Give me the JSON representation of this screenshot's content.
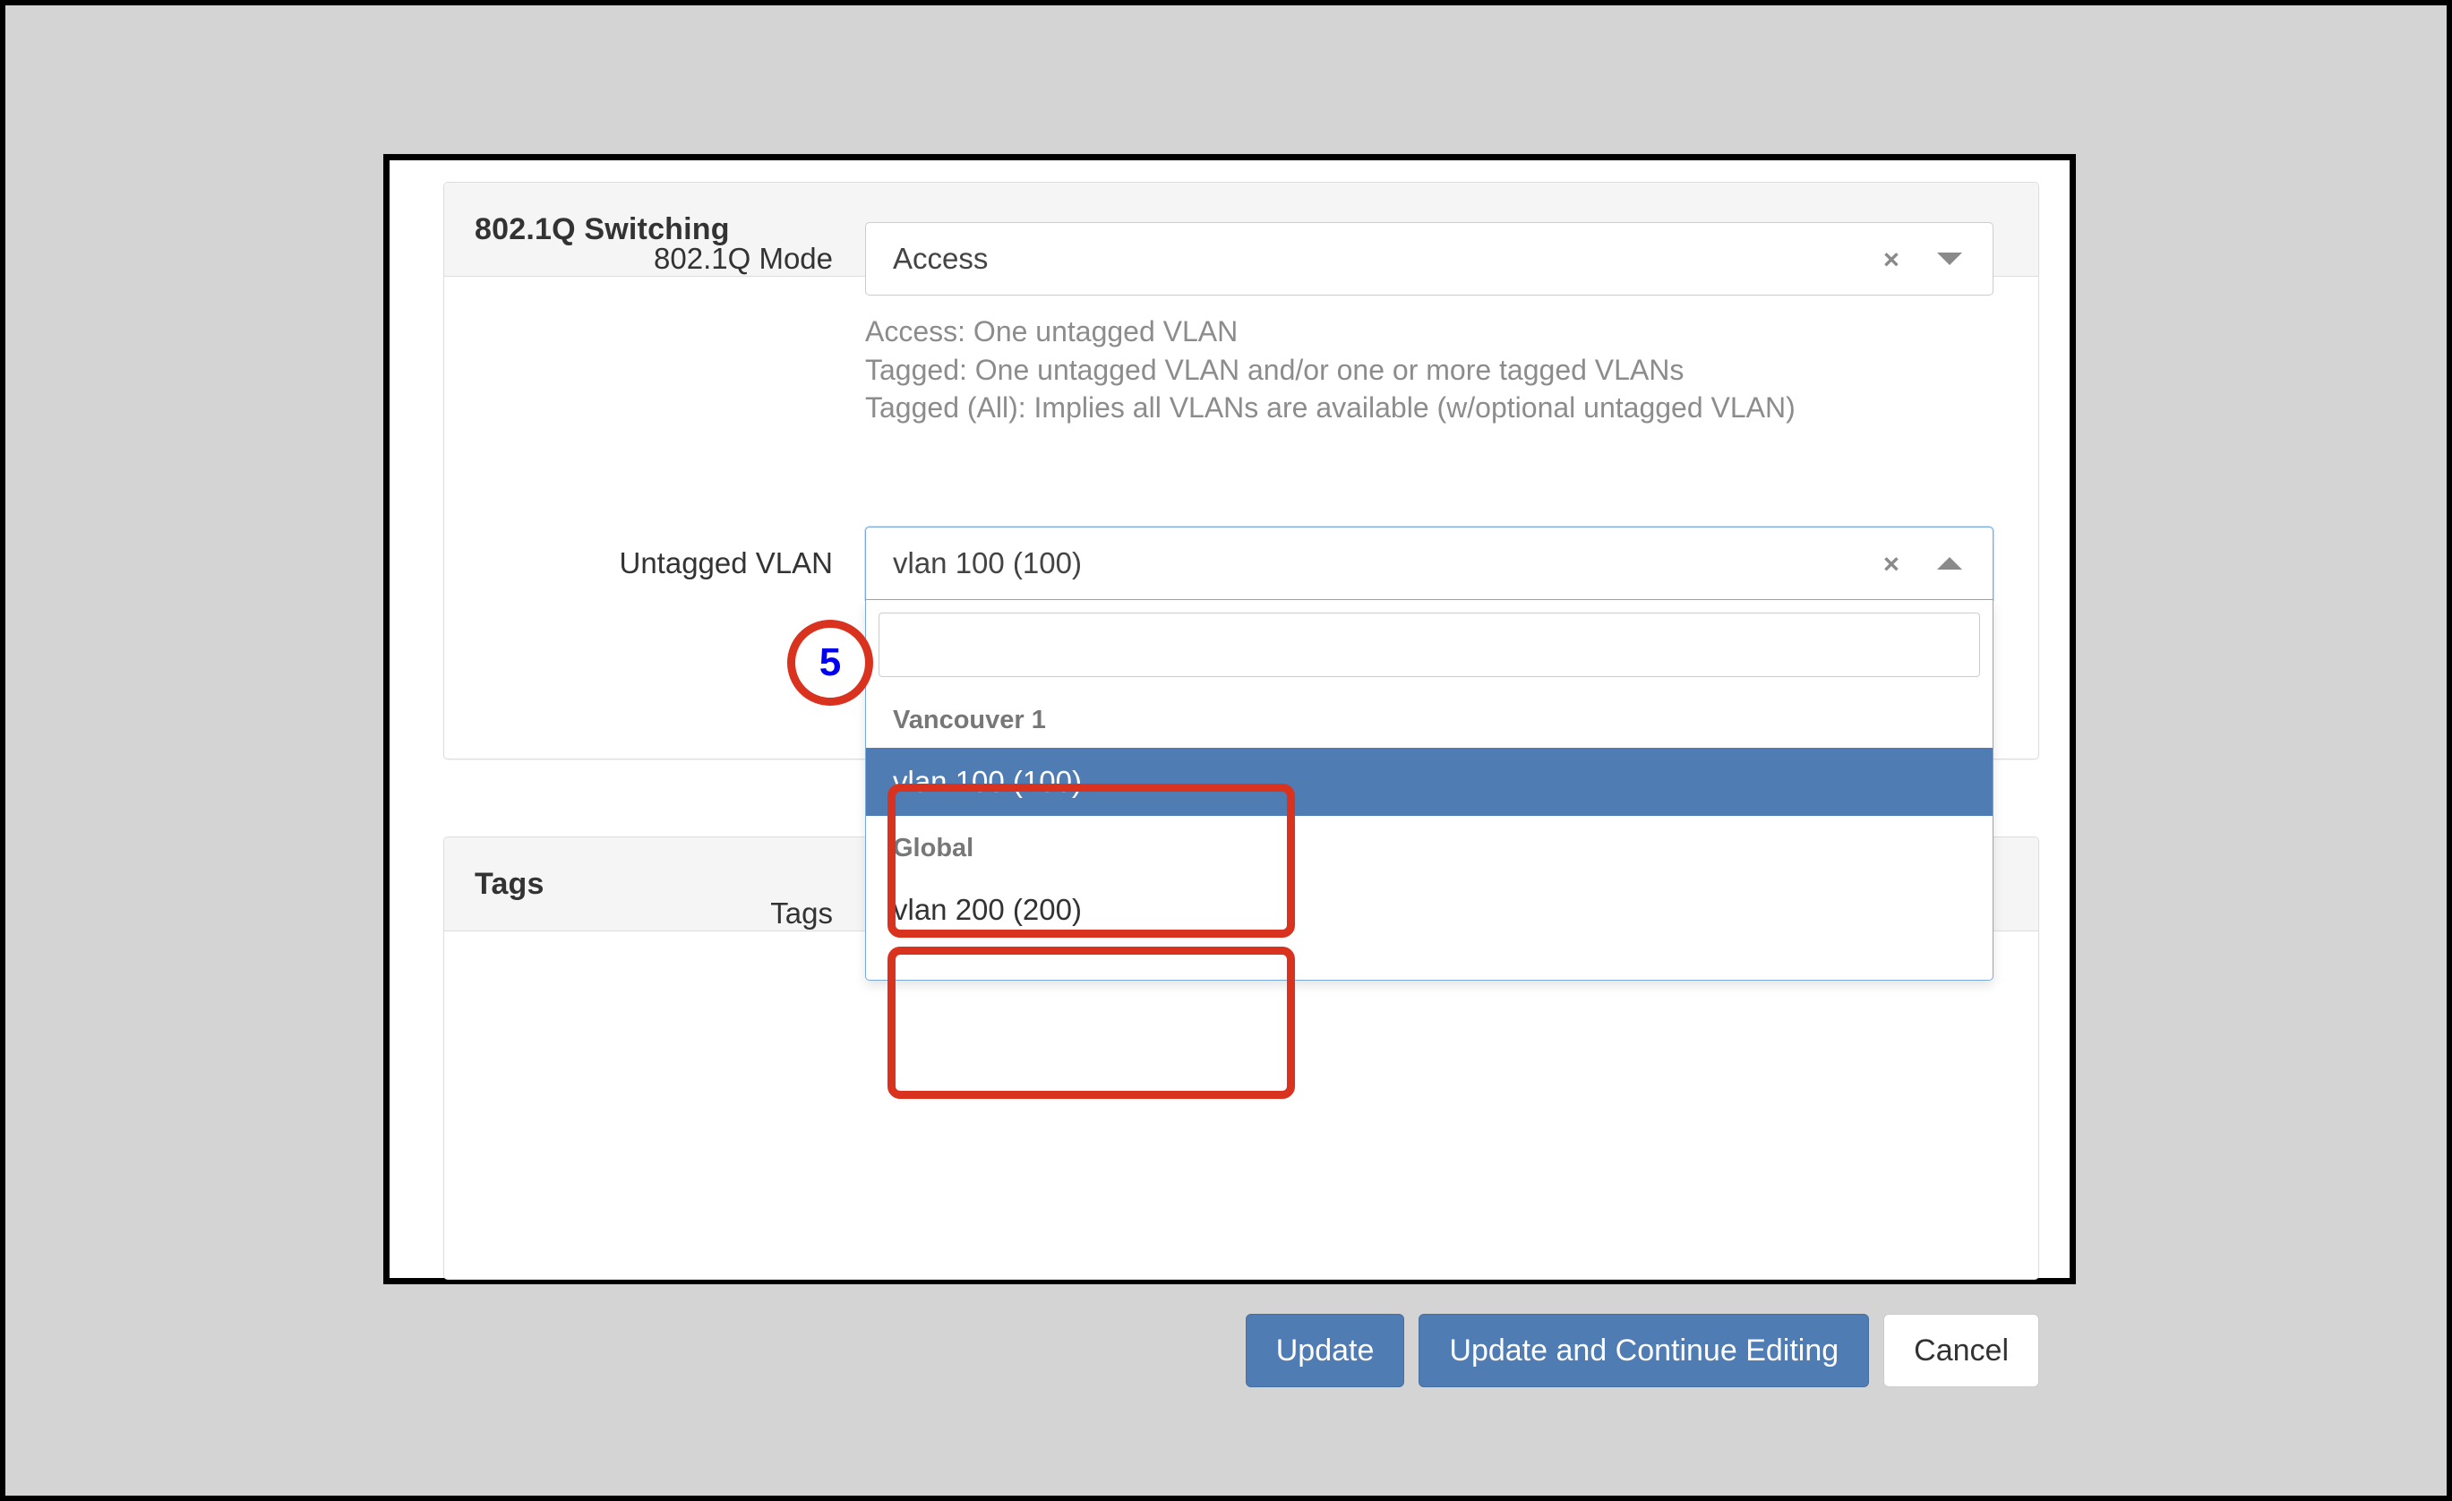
{
  "panels": {
    "switching": {
      "title": "802.1Q Switching",
      "mode_field": {
        "label": "802.1Q Mode",
        "value": "Access",
        "clear_icon": "×",
        "caret_icon": "caret-down"
      },
      "help_lines": [
        "Access: One untagged VLAN",
        "Tagged: One untagged VLAN and/or one or more tagged VLANs",
        "Tagged (All): Implies all VLANs are available (w/optional untagged VLAN)"
      ],
      "untagged_field": {
        "label": "Untagged VLAN",
        "value": "vlan 100 (100)",
        "clear_icon": "×",
        "caret_icon": "caret-up",
        "search_value": "",
        "search_placeholder": "",
        "groups": [
          {
            "group_label": "Vancouver 1",
            "options": [
              {
                "label": "vlan 100 (100)",
                "selected": true
              }
            ]
          },
          {
            "group_label": "Global",
            "options": [
              {
                "label": "vlan 200 (200)",
                "selected": false
              }
            ]
          }
        ]
      }
    },
    "tags": {
      "title": "Tags",
      "field_label": "Tags"
    }
  },
  "footer": {
    "update_label": "Update",
    "update_continue_label": "Update and Continue Editing",
    "cancel_label": "Cancel"
  },
  "annotations": {
    "step_badge": "5"
  },
  "colors": {
    "accent_blue": "#4f7cb3",
    "annotation_red": "#d9321e",
    "badge_text_blue": "#0000ee",
    "panel_header_bg": "#f5f5f5",
    "page_bg": "#d4d4d4"
  }
}
